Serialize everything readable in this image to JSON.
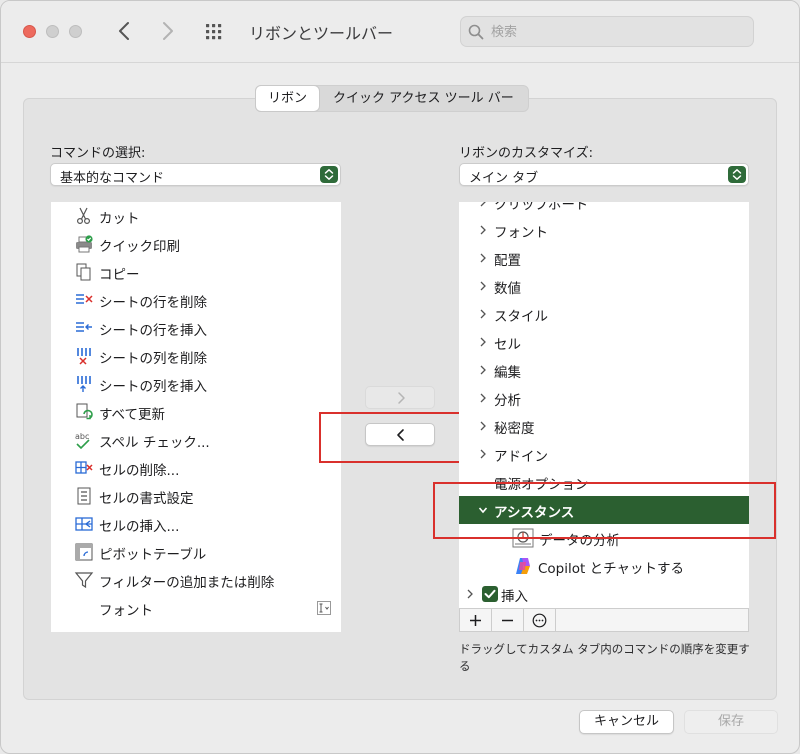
{
  "window": {
    "title": "リボンとツールバー"
  },
  "search": {
    "placeholder": "検索"
  },
  "tabs": [
    {
      "label": "リボン",
      "active": true
    },
    {
      "label": "クイック アクセス ツール バー",
      "active": false
    }
  ],
  "left": {
    "label": "コマンドの選択:",
    "dropdown_value": "基本的なコマンド",
    "items": [
      {
        "label": "カット",
        "icon": "scissors-icon"
      },
      {
        "label": "クイック印刷",
        "icon": "printer-icon"
      },
      {
        "label": "コピー",
        "icon": "copy-icon"
      },
      {
        "label": "シートの行を削除",
        "icon": "delete-rows-icon"
      },
      {
        "label": "シートの行を挿入",
        "icon": "insert-rows-icon"
      },
      {
        "label": "シートの列を削除",
        "icon": "delete-columns-icon"
      },
      {
        "label": "シートの列を挿入",
        "icon": "insert-columns-icon"
      },
      {
        "label": "すべて更新",
        "icon": "refresh-all-icon"
      },
      {
        "label": "スペル チェック...",
        "icon": "spell-check-icon"
      },
      {
        "label": "セルの削除...",
        "icon": "delete-cells-icon"
      },
      {
        "label": "セルの書式設定",
        "icon": "format-cells-icon"
      },
      {
        "label": "セルの挿入...",
        "icon": "insert-cells-icon"
      },
      {
        "label": "ピボットテーブル",
        "icon": "pivot-table-icon"
      },
      {
        "label": "フィルターの追加または削除",
        "icon": "filter-icon"
      },
      {
        "label": "フォント",
        "icon": ""
      }
    ]
  },
  "middle": {
    "add_arrow": "right-chevron-icon",
    "remove_arrow": "left-chevron-icon"
  },
  "right": {
    "label": "リボンのカスタマイズ:",
    "dropdown_value": "メイン タブ",
    "items": [
      {
        "label": "クリップボード",
        "expander": "right"
      },
      {
        "label": "フォント",
        "expander": "right"
      },
      {
        "label": "配置",
        "expander": "right"
      },
      {
        "label": "数値",
        "expander": "right"
      },
      {
        "label": "スタイル",
        "expander": "right"
      },
      {
        "label": "セル",
        "expander": "right"
      },
      {
        "label": "編集",
        "expander": "right"
      },
      {
        "label": "分析",
        "expander": "right"
      },
      {
        "label": "秘密度",
        "expander": "right"
      },
      {
        "label": "アドイン",
        "expander": "right"
      },
      {
        "label": "電源オプション",
        "expander": "none"
      },
      {
        "label": "アシスタンス",
        "expander": "down",
        "selected": true
      },
      {
        "label": "データの分析",
        "icon": "data-analysis-icon"
      },
      {
        "label": "Copilot とチャットする",
        "icon": "copilot-icon"
      },
      {
        "label": "挿入",
        "expander": "right",
        "checked": true
      }
    ]
  },
  "toolbar": {
    "add": "+",
    "remove": "−",
    "more": "⋯"
  },
  "note": "ドラッグしてカスタム タブ内のコマンドの順序を変更する",
  "buttons": {
    "cancel": "キャンセル",
    "save": "保存"
  }
}
